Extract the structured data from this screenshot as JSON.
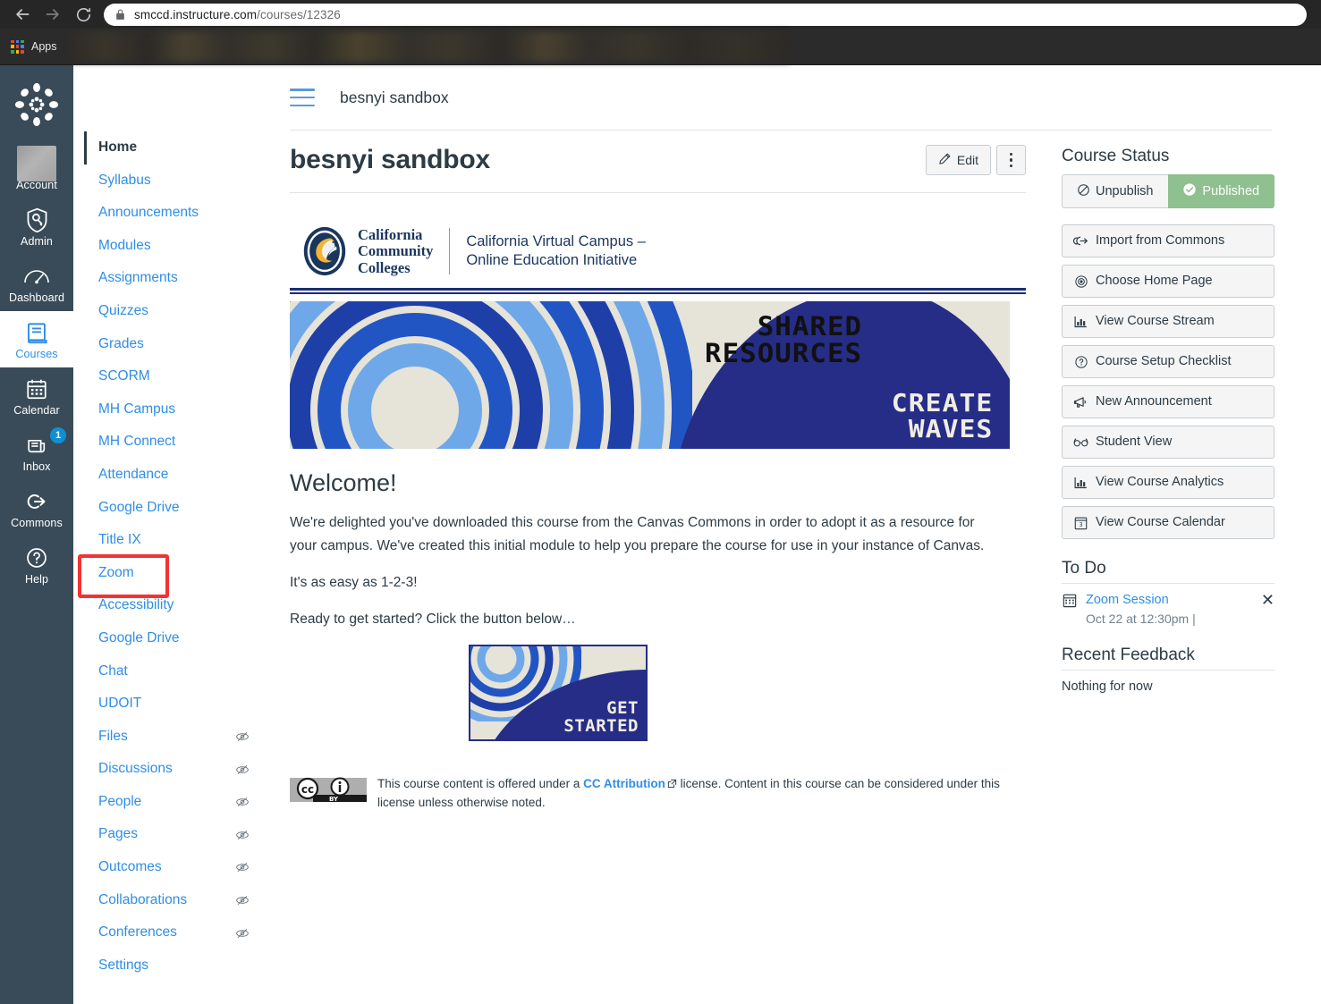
{
  "browser": {
    "back_icon": "back-arrow-icon",
    "forward_icon": "forward-arrow-icon",
    "reload_icon": "reload-icon",
    "lock_icon": "lock-icon",
    "url_domain": "smccd.instructure.com",
    "url_path": "/courses/12326",
    "apps_label": "Apps"
  },
  "global_nav": {
    "logo": "canvas-logo",
    "items": [
      {
        "label": "Account",
        "icon": "avatar-icon",
        "active": false
      },
      {
        "label": "Admin",
        "icon": "shield-key-icon",
        "active": false
      },
      {
        "label": "Dashboard",
        "icon": "speedometer-icon",
        "active": false
      },
      {
        "label": "Courses",
        "icon": "book-icon",
        "active": true
      },
      {
        "label": "Calendar",
        "icon": "calendar-icon",
        "active": false
      },
      {
        "label": "Inbox",
        "icon": "inbox-icon",
        "active": false,
        "badge": "1"
      },
      {
        "label": "Commons",
        "icon": "arrow-out-circle-icon",
        "active": false
      },
      {
        "label": "Help",
        "icon": "question-circle-icon",
        "active": false
      }
    ]
  },
  "course_nav": {
    "items": [
      {
        "label": "Home",
        "active": true,
        "hidden": false
      },
      {
        "label": "Syllabus",
        "active": false,
        "hidden": false
      },
      {
        "label": "Announcements",
        "active": false,
        "hidden": false
      },
      {
        "label": "Modules",
        "active": false,
        "hidden": false
      },
      {
        "label": "Assignments",
        "active": false,
        "hidden": false
      },
      {
        "label": "Quizzes",
        "active": false,
        "hidden": false
      },
      {
        "label": "Grades",
        "active": false,
        "hidden": false
      },
      {
        "label": "SCORM",
        "active": false,
        "hidden": false
      },
      {
        "label": "MH Campus",
        "active": false,
        "hidden": false
      },
      {
        "label": "MH Connect",
        "active": false,
        "hidden": false
      },
      {
        "label": "Attendance",
        "active": false,
        "hidden": false
      },
      {
        "label": "Google Drive",
        "active": false,
        "hidden": false
      },
      {
        "label": "Title IX",
        "active": false,
        "hidden": false
      },
      {
        "label": "Zoom",
        "active": false,
        "hidden": false,
        "highlighted": true
      },
      {
        "label": "Accessibility",
        "active": false,
        "hidden": false
      },
      {
        "label": "Google Drive",
        "active": false,
        "hidden": false
      },
      {
        "label": "Chat",
        "active": false,
        "hidden": false
      },
      {
        "label": "UDOIT",
        "active": false,
        "hidden": false
      },
      {
        "label": "Files",
        "active": false,
        "hidden": true
      },
      {
        "label": "Discussions",
        "active": false,
        "hidden": true
      },
      {
        "label": "People",
        "active": false,
        "hidden": true
      },
      {
        "label": "Pages",
        "active": false,
        "hidden": true
      },
      {
        "label": "Outcomes",
        "active": false,
        "hidden": true
      },
      {
        "label": "Collaborations",
        "active": false,
        "hidden": true
      },
      {
        "label": "Conferences",
        "active": false,
        "hidden": true
      },
      {
        "label": "Settings",
        "active": false,
        "hidden": false
      }
    ],
    "highlight_color": "#f33232"
  },
  "header": {
    "menu_icon": "hamburger-menu-icon",
    "course_name": "besnyi sandbox"
  },
  "main": {
    "page_title": "besnyi sandbox",
    "edit_label": "Edit",
    "edit_icon": "pencil-icon",
    "kebab_icon": "more-options-icon",
    "cvc_logo": {
      "seal_icon": "california-community-colleges-seal",
      "org_line1": "California",
      "org_line2": "Community",
      "org_line3": "Colleges",
      "sub_line1": "California Virtual Campus –",
      "sub_line2": "Online Education Initiative"
    },
    "banner": {
      "headline_line1": "SHARED",
      "headline_line2": "RESOURCES",
      "tagline_line1": "CREATE",
      "tagline_line2": "WAVES",
      "bg_color": "#e6e3d8",
      "blob_color": "#262d86"
    },
    "welcome_heading": "Welcome!",
    "paragraphs": [
      "We're delighted you've downloaded this course from the Canvas Commons in order to adopt it as a resource for your campus. We've created this initial module to help you prepare the course for use in your instance of Canvas.",
      "It's as easy as 1-2-3!",
      "Ready to get started? Click the button below…"
    ],
    "get_started": {
      "line1": "GET",
      "line2": "STARTED"
    },
    "license": {
      "badge_icon": "creative-commons-by-badge",
      "badge_cc": "cc",
      "badge_by": "BY",
      "text_before": "This course content is offered under a ",
      "link_text": "CC Attribution",
      "link_icon": "external-link-icon",
      "text_after": " license. Content in this course can be considered under this license unless otherwise noted."
    }
  },
  "right_sidebar": {
    "course_status_title": "Course Status",
    "unpublish_label": "Unpublish",
    "unpublish_icon": "no-entry-icon",
    "published_label": "Published",
    "published_icon": "check-circle-icon",
    "published_color": "#8fc08f",
    "buttons": [
      {
        "label": "Import from Commons",
        "icon": "commons-import-icon"
      },
      {
        "label": "Choose Home Page",
        "icon": "target-icon"
      },
      {
        "label": "View Course Stream",
        "icon": "chart-icon"
      },
      {
        "label": "Course Setup Checklist",
        "icon": "question-circle-icon"
      },
      {
        "label": "New Announcement",
        "icon": "megaphone-icon"
      },
      {
        "label": "Student View",
        "icon": "glasses-icon"
      },
      {
        "label": "View Course Analytics",
        "icon": "chart-icon"
      },
      {
        "label": "View Course Calendar",
        "icon": "calendar-icon"
      }
    ],
    "todo_title": "To Do",
    "todo_items": [
      {
        "icon": "calendar-icon",
        "title": "Zoom Session",
        "date": "Oct 22 at 12:30pm  |",
        "dismiss_icon": "close-icon"
      }
    ],
    "feedback_title": "Recent Feedback",
    "feedback_empty": "Nothing for now"
  }
}
